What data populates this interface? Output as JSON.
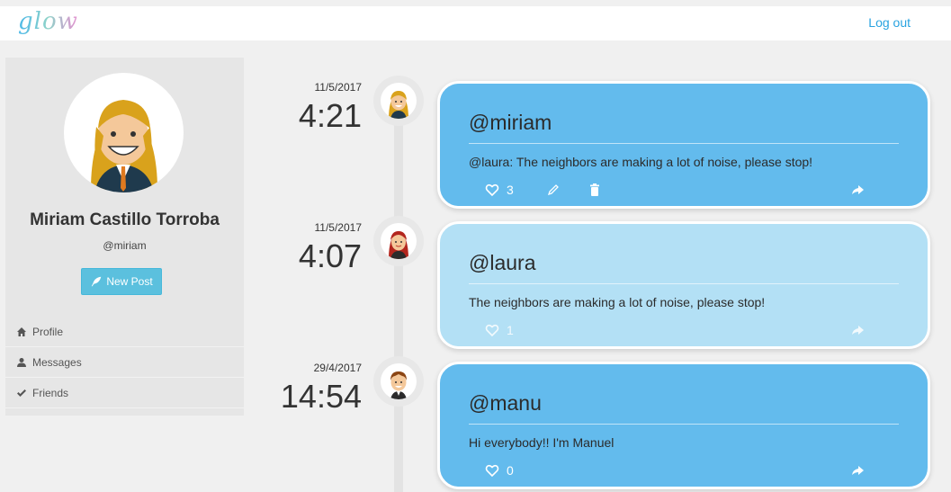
{
  "app": {
    "logo": "glow",
    "logout_label": "Log out"
  },
  "profile": {
    "name": "Miriam Castillo Torroba",
    "handle": "@miriam",
    "new_post_label": "New Post"
  },
  "nav": {
    "items": [
      {
        "label": "Profile",
        "icon": "home-icon"
      },
      {
        "label": "Messages",
        "icon": "user-icon"
      },
      {
        "label": "Friends",
        "icon": "check-icon"
      }
    ]
  },
  "posts": [
    {
      "date": "11/5/2017",
      "time": "4:21",
      "user": "@miriam",
      "text": "@laura: The neighbors are making a lot of noise, please stop!",
      "likes": "3",
      "editable": true,
      "style": "dark"
    },
    {
      "date": "11/5/2017",
      "time": "4:07",
      "user": "@laura",
      "text": "The neighbors are making a lot of noise, please stop!",
      "likes": "1",
      "editable": false,
      "style": "light"
    },
    {
      "date": "29/4/2017",
      "time": "14:54",
      "user": "@manu",
      "text": "Hi everybody!! I'm Manuel",
      "likes": "0",
      "editable": false,
      "style": "dark"
    }
  ],
  "colors": {
    "accent": "#29a3e0",
    "card_dark": "#63bbed",
    "card_light": "#b3e0f5",
    "button": "#5bc0de"
  }
}
